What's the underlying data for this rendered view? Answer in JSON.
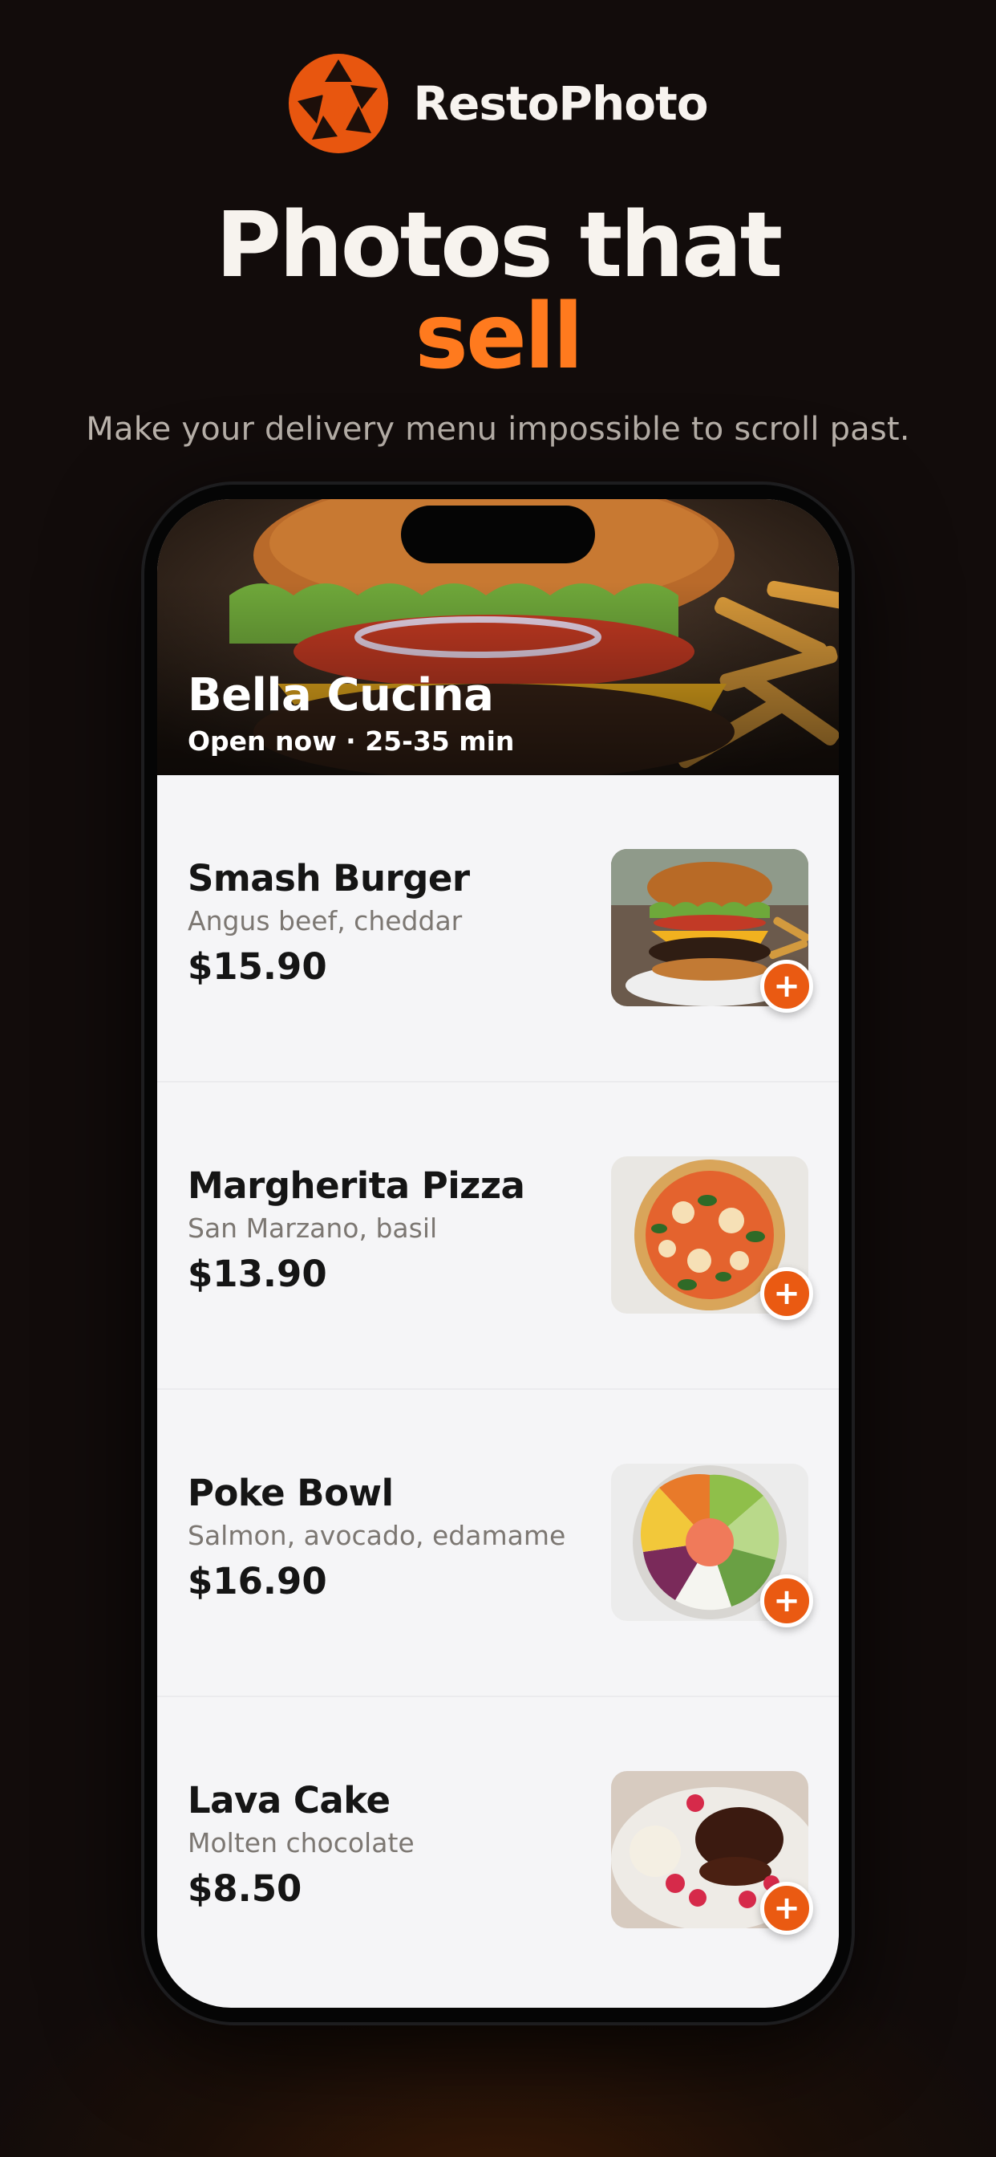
{
  "brand": {
    "name": "RestoPhoto",
    "logo_icon": "camera-aperture-fork-knife-icon",
    "accent": "#EA5A12"
  },
  "hero": {
    "line1": "Photos that",
    "line2": "sell",
    "subtitle": "Make your delivery menu impossible to scroll past."
  },
  "restaurant": {
    "name": "Bella Cucina",
    "meta": "Open now · 25-35 min",
    "cover_image": "burger-cover-photo"
  },
  "menu": [
    {
      "name": "Smash Burger",
      "description": "Angus beef, cheddar",
      "price": "$15.90",
      "image": "burger-photo",
      "add_icon": "plus-icon"
    },
    {
      "name": "Margherita Pizza",
      "description": "San Marzano, basil",
      "price": "$13.90",
      "image": "pizza-photo",
      "add_icon": "plus-icon"
    },
    {
      "name": "Poke Bowl",
      "description": "Salmon, avocado, edamame",
      "price": "$16.90",
      "image": "poke-bowl-photo",
      "add_icon": "plus-icon"
    },
    {
      "name": "Lava Cake",
      "description": "Molten chocolate",
      "price": "$8.50",
      "image": "lava-cake-photo",
      "add_icon": "plus-icon"
    }
  ],
  "add_symbol": "+"
}
